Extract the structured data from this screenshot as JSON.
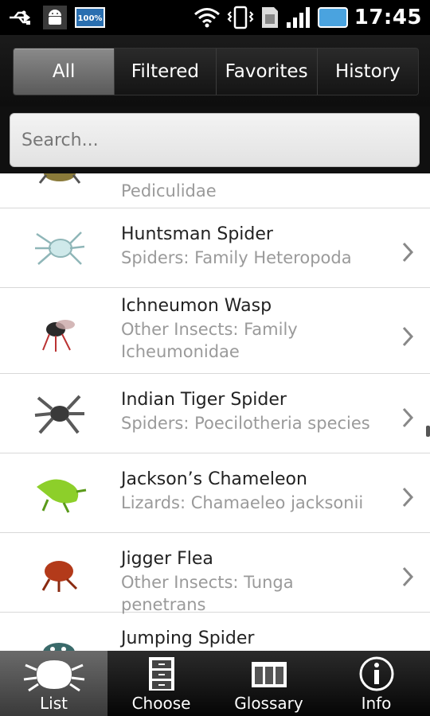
{
  "status": {
    "time": "17:45",
    "battery_badge": "100%"
  },
  "tabs": [
    {
      "label": "All",
      "active": true
    },
    {
      "label": "Filtered",
      "active": false
    },
    {
      "label": "Favorites",
      "active": false
    },
    {
      "label": "History",
      "active": false
    }
  ],
  "search": {
    "placeholder": "Search..."
  },
  "list": [
    {
      "name": "",
      "sub": "Pediculidae"
    },
    {
      "name": "Huntsman Spider",
      "sub": "Spiders: Family Heteropoda"
    },
    {
      "name": "Ichneumon Wasp",
      "sub": "Other Insects: Family Icheumonidae"
    },
    {
      "name": "Indian Tiger Spider",
      "sub": "Spiders: Poecilotheria species"
    },
    {
      "name": "Jackson’s Chameleon",
      "sub": "Lizards: Chamaeleo jacksonii"
    },
    {
      "name": "Jigger Flea",
      "sub": "Other Insects: Tunga penetrans"
    },
    {
      "name": "Jumping Spider",
      "sub": ""
    }
  ],
  "bottom_tabs": [
    {
      "label": "List",
      "icon": "bug-icon",
      "active": true
    },
    {
      "label": "Choose",
      "icon": "cabinet-icon",
      "active": false
    },
    {
      "label": "Glossary",
      "icon": "books-icon",
      "active": false
    },
    {
      "label": "Info",
      "icon": "info-icon",
      "active": false
    }
  ]
}
